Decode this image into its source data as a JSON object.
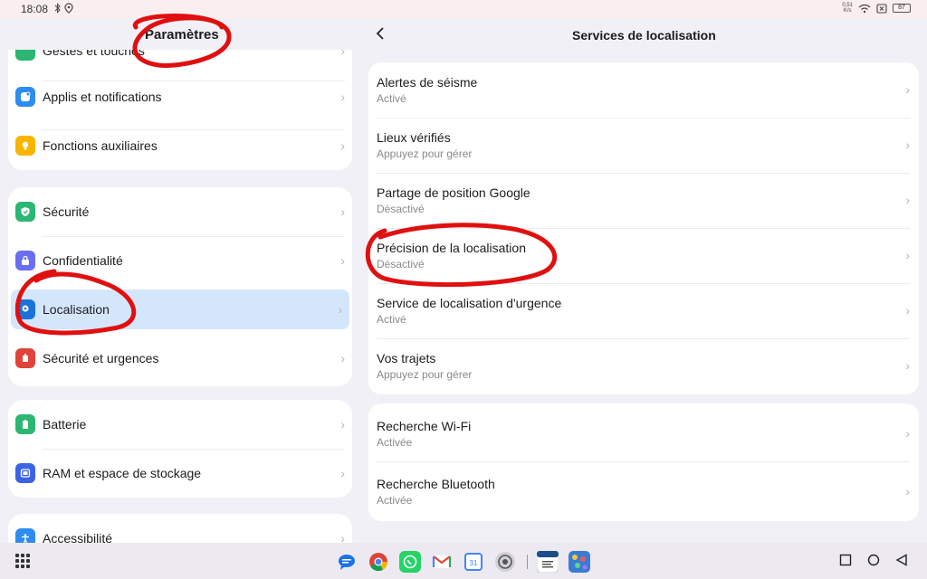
{
  "status_bar": {
    "time": "18:08",
    "net_speed": "0,51",
    "net_unit": "K/s",
    "battery": "87"
  },
  "left": {
    "title": "Paramètres",
    "partial_top_label": "Gestes et touches",
    "card1": [
      {
        "label": "Applis et notifications",
        "icon": "apps-icon",
        "color": "#2d8cf0"
      },
      {
        "label": "Fonctions auxiliaires",
        "icon": "bulb-icon",
        "color": "#f7b500"
      }
    ],
    "card2": [
      {
        "label": "Sécurité",
        "icon": "shield-check-icon",
        "color": "#2bb673"
      },
      {
        "label": "Confidentialité",
        "icon": "lock-icon",
        "color": "#6a6ef0"
      },
      {
        "label": "Localisation",
        "icon": "location-pin-icon",
        "color": "#1a73d9"
      },
      {
        "label": "Sécurité et urgences",
        "icon": "emergency-icon",
        "color": "#e0433a"
      }
    ],
    "card3": [
      {
        "label": "Batterie",
        "icon": "battery-icon",
        "color": "#2bb673"
      },
      {
        "label": "RAM et espace de stockage",
        "icon": "storage-icon",
        "color": "#3b63e6"
      }
    ],
    "card4": [
      {
        "label": "Accessibilité",
        "icon": "accessibility-icon",
        "color": "#2d8cf0"
      }
    ]
  },
  "right": {
    "title": "Services de localisation",
    "group1": [
      {
        "title": "Alertes de séisme",
        "sub": "Activé"
      },
      {
        "title": "Lieux vérifiés",
        "sub": "Appuyez pour gérer"
      },
      {
        "title": "Partage de position Google",
        "sub": "Désactivé"
      },
      {
        "title": "Précision de la localisation",
        "sub": "Désactivé"
      },
      {
        "title": "Service de localisation d'urgence",
        "sub": "Activé"
      },
      {
        "title": "Vos trajets",
        "sub": "Appuyez pour gérer"
      }
    ],
    "group2": [
      {
        "title": "Recherche Wi-Fi",
        "sub": "Activée"
      },
      {
        "title": "Recherche Bluetooth",
        "sub": "Activée"
      }
    ]
  },
  "dock": {
    "apps": [
      "messages-icon",
      "chrome-icon",
      "whatsapp-icon",
      "gmail-icon",
      "calendar-icon",
      "settings-app-icon",
      "document-app-icon",
      "game-app-icon"
    ],
    "calendar_day": "31"
  },
  "colors": {
    "selected_row": "#d4e6fb",
    "annotation": "#e01010"
  }
}
